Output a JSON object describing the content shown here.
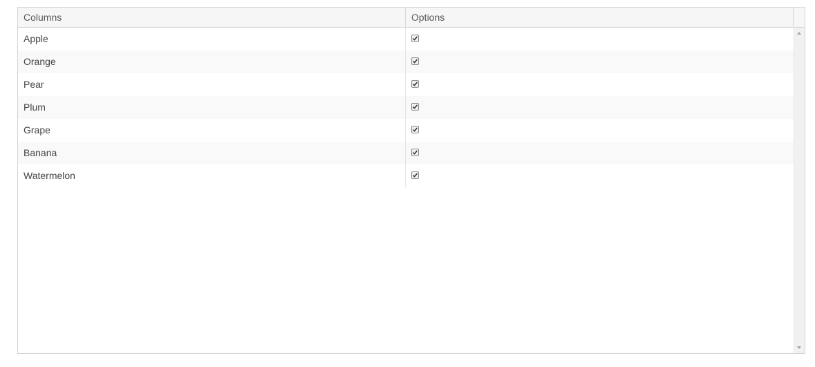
{
  "grid": {
    "headers": {
      "columns": "Columns",
      "options": "Options"
    },
    "rows": [
      {
        "label": "Apple",
        "checked": true
      },
      {
        "label": "Orange",
        "checked": true
      },
      {
        "label": "Pear",
        "checked": true
      },
      {
        "label": "Plum",
        "checked": true
      },
      {
        "label": "Grape",
        "checked": true
      },
      {
        "label": "Banana",
        "checked": true
      },
      {
        "label": "Watermelon",
        "checked": true
      }
    ]
  },
  "icons": {
    "checkbox": "checkmark-icon",
    "scroll_up": "arrow-up-icon",
    "scroll_down": "arrow-down-icon"
  },
  "colors": {
    "border": "#d4d4d4",
    "header_bg": "#f6f6f6",
    "alt_row_bg": "#f9f9f9",
    "text": "#444444"
  }
}
